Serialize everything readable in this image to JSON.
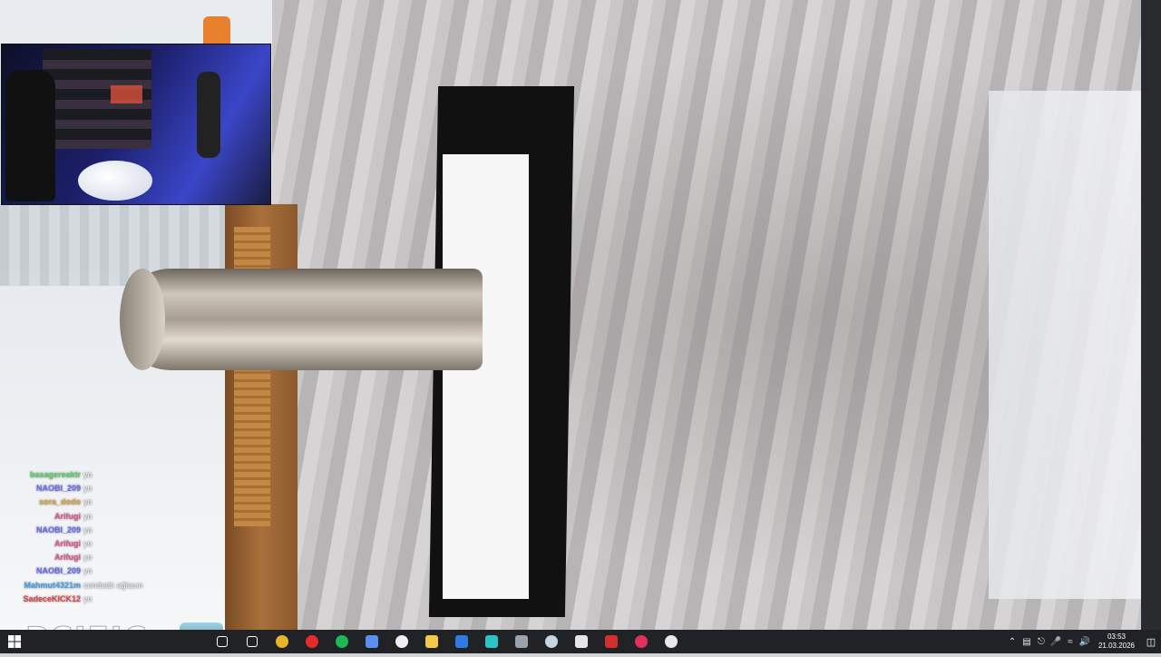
{
  "chat": {
    "messages": [
      {
        "user": "basagereaktr",
        "text": "yo",
        "color": "#56d364"
      },
      {
        "user": "NAOBI_209",
        "text": "yo",
        "color": "#6a6cf0"
      },
      {
        "user": "sora_dodo",
        "text": "yo",
        "color": "#d9a441"
      },
      {
        "user": "Arifugi",
        "text": "yo",
        "color": "#e0548b"
      },
      {
        "user": "NAOBI_209",
        "text": "yo",
        "color": "#6a6cf0"
      },
      {
        "user": "Arifugi",
        "text": "yo",
        "color": "#e0548b"
      },
      {
        "user": "Arifugi",
        "text": "yo",
        "color": "#e0548b"
      },
      {
        "user": "NAOBI_209",
        "text": "yo",
        "color": "#6a6cf0"
      },
      {
        "user": "Mahmut4321m",
        "text": "combatlı ağlasın",
        "color": "#4aa3e8"
      },
      {
        "user": "SadeceKICK12",
        "text": "yo",
        "color": "#e04848"
      }
    ]
  },
  "watermark": {
    "text": "PCIFIC"
  },
  "taskbar": {
    "apps": [
      {
        "name": "search",
        "icon": "search-icon",
        "color": "#ffffff"
      },
      {
        "name": "task-view",
        "icon": "task-view-icon",
        "color": "#ffffff"
      },
      {
        "name": "chrome",
        "icon": "chrome-icon",
        "color": "#e8b62c"
      },
      {
        "name": "opera",
        "icon": "opera-icon",
        "color": "#e32b2b"
      },
      {
        "name": "spotify",
        "icon": "spotify-icon",
        "color": "#1db954"
      },
      {
        "name": "app-blue",
        "icon": "droplet-icon",
        "color": "#5b8ff0"
      },
      {
        "name": "github",
        "icon": "github-icon",
        "color": "#f0f0f0"
      },
      {
        "name": "file-explorer",
        "icon": "folder-icon",
        "color": "#f2c94c"
      },
      {
        "name": "outlook",
        "icon": "outlook-icon",
        "color": "#2d7be0"
      },
      {
        "name": "app-teal",
        "icon": "puzzle-icon",
        "color": "#2bc3c3"
      },
      {
        "name": "calculator",
        "icon": "calculator-icon",
        "color": "#9aa3ad"
      },
      {
        "name": "steam",
        "icon": "steam-icon",
        "color": "#c7d5e0"
      },
      {
        "name": "epic-games",
        "icon": "epic-icon",
        "color": "#e6e6e6"
      },
      {
        "name": "voicemeeter",
        "icon": "voicemeeter-icon",
        "color": "#d22f2f"
      },
      {
        "name": "opera-gx",
        "icon": "opera-gx-icon",
        "color": "#e0325a"
      },
      {
        "name": "obs",
        "icon": "obs-icon",
        "color": "#e9e9e9"
      }
    ],
    "clock": {
      "time": "03:53",
      "date": "21.03.2026"
    }
  }
}
